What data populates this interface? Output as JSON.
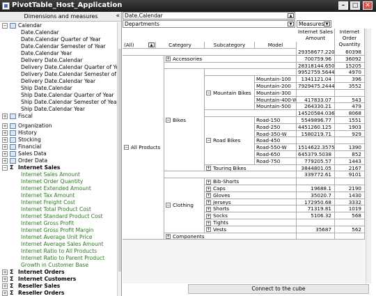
{
  "window": {
    "title": "PivotTable_Host_Application",
    "min": "–",
    "max": "□",
    "close": "✕"
  },
  "left_panel": {
    "header": "Dimensions and measures",
    "collapse": "«",
    "tree": [
      {
        "kind": "node",
        "expander": "⊟",
        "icon": "dim",
        "label": "Calendar"
      },
      {
        "kind": "leaf",
        "label": "Date.Calendar"
      },
      {
        "kind": "leaf",
        "label": "Date.Calendar Quarter of Year"
      },
      {
        "kind": "leaf",
        "label": "Date.Calendar Semester of Year"
      },
      {
        "kind": "leaf",
        "label": "Date.Calendar Year"
      },
      {
        "kind": "leaf",
        "label": "Delivery Date.Calendar"
      },
      {
        "kind": "leaf",
        "label": "Delivery Date.Calendar Quarter of Year"
      },
      {
        "kind": "leaf",
        "label": "Delivery Date.Calendar Semester of Year"
      },
      {
        "kind": "leaf",
        "label": "Delivery Date.Calendar Year"
      },
      {
        "kind": "leaf",
        "label": "Ship Date.Calendar"
      },
      {
        "kind": "leaf",
        "label": "Ship Date.Calendar Quarter of Year"
      },
      {
        "kind": "leaf",
        "label": "Ship Date.Calendar Semester of Year"
      },
      {
        "kind": "leaf",
        "label": "Ship Date.Calendar Year"
      },
      {
        "kind": "node",
        "expander": "⊞",
        "icon": "dim",
        "label": "Fiscal"
      },
      {
        "kind": "gap"
      },
      {
        "kind": "node",
        "expander": "⊞",
        "icon": "dim",
        "label": "Organization"
      },
      {
        "kind": "node",
        "expander": "⊞",
        "icon": "dim",
        "label": "History"
      },
      {
        "kind": "node",
        "expander": "⊞",
        "icon": "dim",
        "label": "Stocking"
      },
      {
        "kind": "node",
        "expander": "⊞",
        "icon": "dim",
        "label": "Financial"
      },
      {
        "kind": "node",
        "expander": "⊞",
        "icon": "dim",
        "label": "Sales Data"
      },
      {
        "kind": "node",
        "expander": "⊞",
        "icon": "dim",
        "label": "Order Data"
      },
      {
        "kind": "node",
        "expander": "⊟",
        "icon": "sigma",
        "label": "Internet Sales",
        "bold": true
      },
      {
        "kind": "measure",
        "label": "Internet Sales Amount"
      },
      {
        "kind": "measure",
        "label": "Internet Order Quantity"
      },
      {
        "kind": "measure",
        "label": "Internet Extended Amount"
      },
      {
        "kind": "measure",
        "label": "Internet Tax Amount"
      },
      {
        "kind": "measure",
        "label": "Internet Freight Cost"
      },
      {
        "kind": "measure",
        "label": "Internet Total Product Cost"
      },
      {
        "kind": "measure",
        "label": "Internet Standard Product Cost"
      },
      {
        "kind": "measure",
        "label": "Internet Gross Profit"
      },
      {
        "kind": "measure",
        "label": "Internet Gross Profit Margin"
      },
      {
        "kind": "measure",
        "label": "Internet Average Unit Price"
      },
      {
        "kind": "measure",
        "label": "Internet Average Sales Amount"
      },
      {
        "kind": "measure",
        "label": "Internet Ratio to All Products"
      },
      {
        "kind": "measure",
        "label": "Internet Ratio to Parent Product"
      },
      {
        "kind": "measure",
        "label": "Growth in Customer Base"
      },
      {
        "kind": "node",
        "expander": "⊞",
        "icon": "sigma",
        "label": "Internet Orders",
        "bold": true
      },
      {
        "kind": "node",
        "expander": "⊞",
        "icon": "sigma",
        "label": "Internet Customers",
        "bold": true
      },
      {
        "kind": "node",
        "expander": "⊞",
        "icon": "sigma",
        "label": "Reseller Sales",
        "bold": true
      },
      {
        "kind": "node",
        "expander": "⊞",
        "icon": "sigma",
        "label": "Reseller Orders",
        "bold": true
      }
    ]
  },
  "pivot": {
    "column_filter": "Date.Calendar",
    "row_filter": "Departments",
    "measures_label": "Measures",
    "all_label": "(All)",
    "col_headers": [
      "Category",
      "Subcategory",
      "Model"
    ],
    "measure_headers": [
      "Internet Sales Amount",
      "Internet Order Quantity"
    ],
    "all_products": "All Products",
    "categories": {
      "accessories": "Accessories",
      "bikes": "Bikes",
      "clothing": "Clothing",
      "components": "Components"
    },
    "subcategories": {
      "mountain": "Mountain Bikes",
      "road": "Road Bikes",
      "touring": "Touring Bikes"
    },
    "mountain_models": [
      "Mountain-100",
      "Mountain-200",
      "Mountain-300",
      "Mountain-400-W",
      "Mountain-500"
    ],
    "road_models": [
      "Road-150",
      "Road-250",
      "Road-350-W",
      "Road-450",
      "Road-550-W",
      "Road-650",
      "Road-750"
    ],
    "clothing_subs": [
      "Bib-Shorts",
      "Caps",
      "Gloves",
      "Jerseys",
      "Shorts",
      "Socks",
      "Tights",
      "Vests"
    ],
    "values": [
      [
        "29358677.2207",
        "60398"
      ],
      [
        "700759.96",
        "36092"
      ],
      [
        "28318144.6507",
        "15205"
      ],
      [
        "9952759.5644",
        "4970"
      ],
      [
        "1341121.04",
        "396"
      ],
      [
        "7929475.2444",
        "3552"
      ],
      [
        "",
        ""
      ],
      [
        "417833.07",
        "543"
      ],
      [
        "264330.21",
        "479"
      ],
      [
        "14520584.0363",
        "8068"
      ],
      [
        "5549896.77",
        "1551"
      ],
      [
        "4451260.125",
        "1903"
      ],
      [
        "1580219.71",
        "929"
      ],
      [
        "",
        ""
      ],
      [
        "1514622.3575",
        "1390"
      ],
      [
        "645379.5038",
        "852"
      ],
      [
        "779205.57",
        "1443"
      ],
      [
        "3844801.05",
        "2167"
      ],
      [
        "339772.61",
        "9101"
      ],
      [
        "",
        ""
      ],
      [
        "19688.1",
        "2190"
      ],
      [
        "35020.7",
        "1430"
      ],
      [
        "172950.68",
        "3332"
      ],
      [
        "71319.81",
        "1019"
      ],
      [
        "5106.32",
        "568"
      ],
      [
        "",
        ""
      ],
      [
        "35687",
        "562"
      ],
      [
        "",
        ""
      ]
    ]
  },
  "status": {
    "connect_label": "Connect to the cube"
  }
}
